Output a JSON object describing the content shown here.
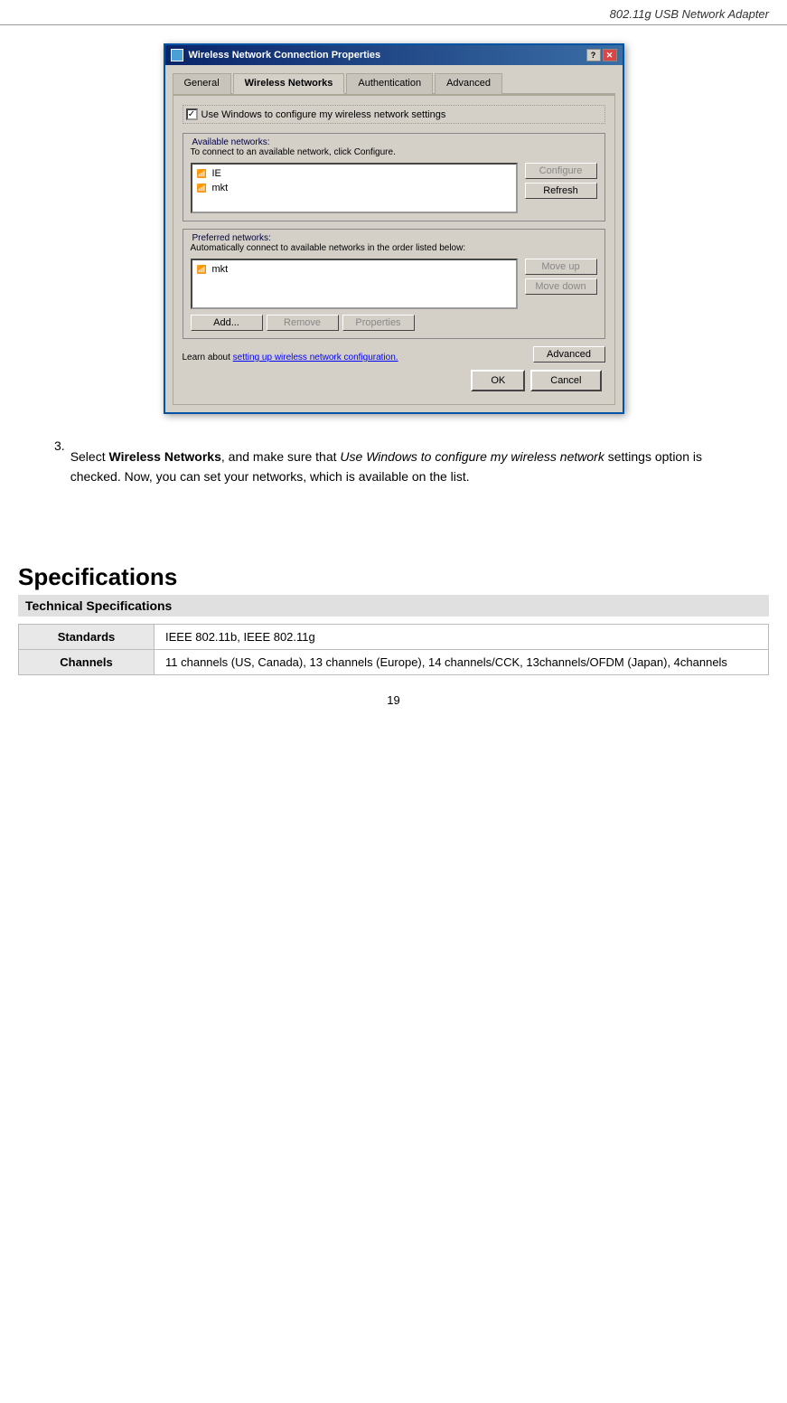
{
  "header": {
    "title": "802.11g USB Network Adapter"
  },
  "dialog": {
    "title": "Wireless Network Connection Properties",
    "tabs": [
      {
        "label": "General",
        "active": false
      },
      {
        "label": "Wireless Networks",
        "active": true
      },
      {
        "label": "Authentication",
        "active": false
      },
      {
        "label": "Advanced",
        "active": false
      }
    ],
    "checkbox_label": "Use Windows to configure my wireless network settings",
    "available_networks": {
      "legend": "Available networks:",
      "description": "To connect to an available network, click Configure.",
      "networks": [
        {
          "name": "IE"
        },
        {
          "name": "mkt"
        }
      ],
      "buttons": {
        "configure": "Configure",
        "refresh": "Refresh"
      }
    },
    "preferred_networks": {
      "legend": "Preferred networks:",
      "description": "Automatically connect to available networks in the order listed below:",
      "networks": [
        {
          "name": "mkt"
        }
      ],
      "buttons": {
        "move_up": "Move up",
        "move_down": "Move down",
        "add": "Add...",
        "remove": "Remove",
        "properties": "Properties"
      }
    },
    "learn_text": "Learn about",
    "learn_link": "setting up wireless network configuration.",
    "advanced_button": "Advanced",
    "ok_button": "OK",
    "cancel_button": "Cancel"
  },
  "step3": {
    "number": "3.",
    "text_before_bold": "Select ",
    "bold_text": "Wireless Networks",
    "text_italic": ", and make sure that ",
    "italic_text": "Use Windows to configure my wireless network",
    "text_after_italic": " settings option is checked. Now, you can set your networks, which is available on the list."
  },
  "specifications": {
    "title": "Specifications",
    "subtitle": "Technical Specifications",
    "table": [
      {
        "header": "Standards",
        "value": "IEEE 802.11b, IEEE 802.11g"
      },
      {
        "header": "Channels",
        "value": "11 channels (US, Canada), 13 channels (Europe), 14 channels/CCK, 13channels/OFDM (Japan), 4channels"
      }
    ]
  },
  "page_number": "19"
}
